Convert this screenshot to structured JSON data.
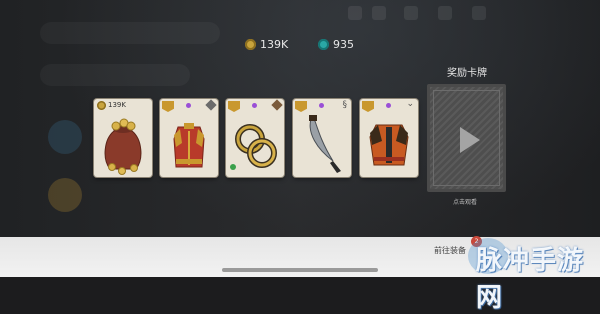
{
  "currency": {
    "gold": "139K",
    "gems": "935"
  },
  "rewards": {
    "title": "奖励卡牌",
    "cards": [
      {
        "name": "gold-pouch",
        "amount": "139K"
      },
      {
        "name": "red-chest-armor"
      },
      {
        "name": "gold-rings"
      },
      {
        "name": "curved-dagger"
      },
      {
        "name": "orange-armor"
      }
    ],
    "video_label": "点击观看"
  },
  "bottom": {
    "equip_label": "前往装备",
    "badge_count": "2"
  },
  "watermark": "脉冲手游网",
  "colors": {
    "gold": "#c9a43c",
    "gem": "#2aa7a5",
    "rarity_purple": "#9a4fd6",
    "rarity_green": "#3aa04a",
    "card_bg": "#e9e3d5"
  }
}
